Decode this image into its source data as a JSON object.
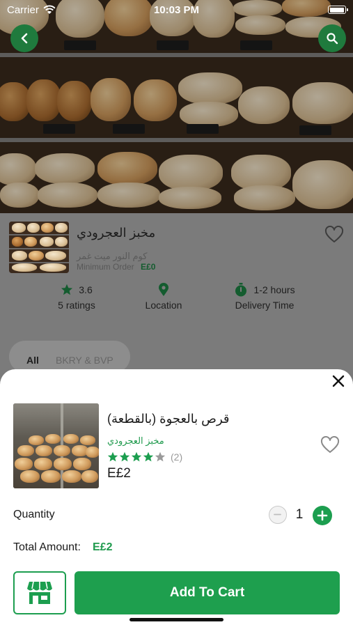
{
  "status_bar": {
    "carrier": "Carrier",
    "time": "10:03 PM"
  },
  "shop": {
    "name": "مخبز العجرودي",
    "area": "كوم النور ميت غمر",
    "min_order_label": "Minimum Order",
    "min_order_value": "E£0"
  },
  "stats": {
    "rating_value": "3.6",
    "rating_count": "5 ratings",
    "location": "Location",
    "delivery_value": "1-2 hours",
    "delivery_label": "Delivery Time"
  },
  "tabs": [
    {
      "label": "All"
    },
    {
      "label": "BKRY & BVP"
    }
  ],
  "product": {
    "name": "قرص بالعجوة (بالقطعة)",
    "shop": "مخبز العجرودي",
    "rating": 4,
    "rating_max": 5,
    "review_count": "(2)",
    "price": "E£2"
  },
  "quantity": {
    "label": "Quantity",
    "value": "1"
  },
  "total": {
    "label": "Total Amount:",
    "value": "E£2"
  },
  "actions": {
    "add_to_cart": "Add To Cart"
  },
  "icons": [
    "wifi-icon",
    "battery-icon",
    "back-arrow-icon",
    "search-icon",
    "heart-icon",
    "star-icon",
    "location-pin-icon",
    "stopwatch-icon",
    "close-icon",
    "minus-icon",
    "plus-icon",
    "store-icon"
  ],
  "colors": {
    "brand_green": "#1e9f4e",
    "dark_green": "#1f7a3d",
    "star_green": "#1c9e4f"
  }
}
